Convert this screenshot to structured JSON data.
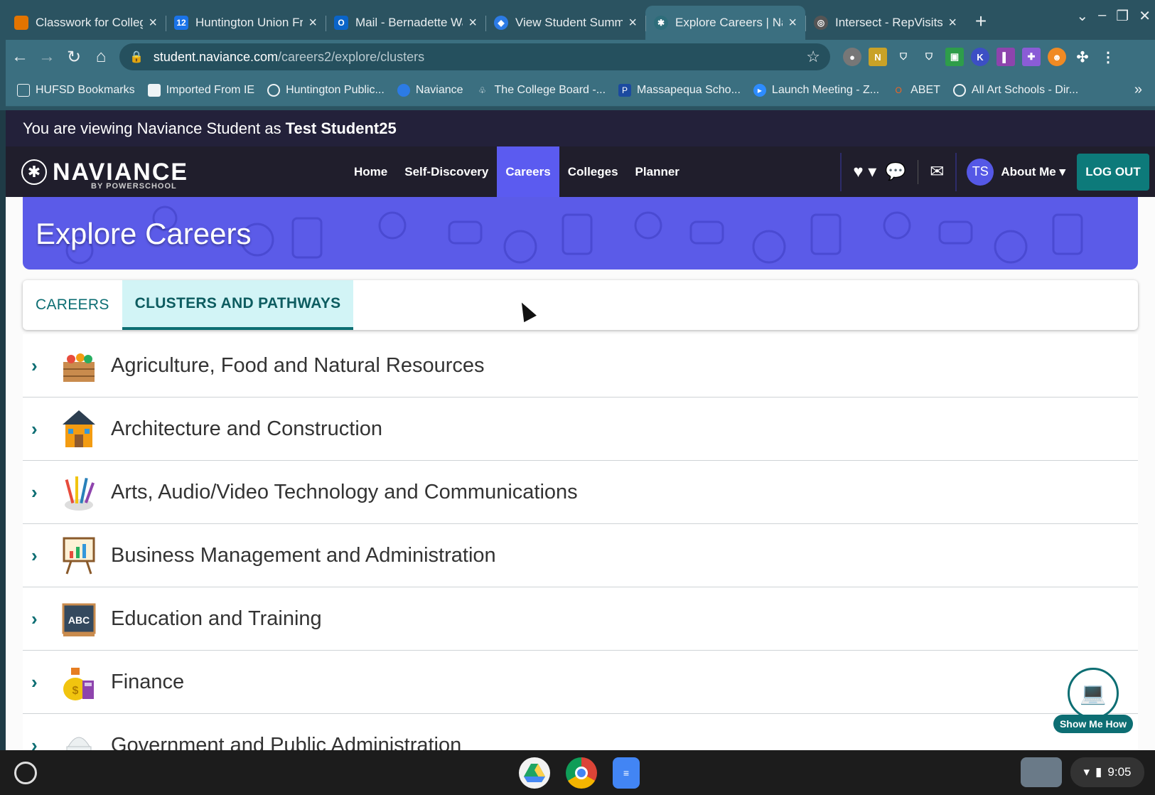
{
  "browser": {
    "tabs": [
      {
        "title": "Classwork for College C",
        "fav_color": "#e37400",
        "fav_glyph": "▮"
      },
      {
        "title": "Huntington Union Free",
        "fav_color": "#1a73e8",
        "fav_glyph": "12"
      },
      {
        "title": "Mail - Bernadette Walsh",
        "fav_color": "#0a64c8",
        "fav_glyph": "O"
      },
      {
        "title": "View Student Summary",
        "fav_color": "#2c7be5",
        "fav_glyph": "◆"
      },
      {
        "title": "Explore Careers | Navia",
        "fav_color": "#2e6d7a",
        "fav_glyph": "✱",
        "active": true
      },
      {
        "title": "Intersect - RepVisits",
        "fav_color": "#555555",
        "fav_glyph": "◎"
      }
    ],
    "url_host": "student.naviance.com",
    "url_path": "/careers2/explore/clusters",
    "bookmarks": [
      {
        "label": "HUFSD Bookmarks",
        "icon": "folder-icon"
      },
      {
        "label": "Imported From IE",
        "icon": "folder-icon"
      },
      {
        "label": "Huntington Public...",
        "icon": "globe-icon"
      },
      {
        "label": "Naviance",
        "icon": "naviance-icon"
      },
      {
        "label": "The College Board -...",
        "icon": "acorn-icon"
      },
      {
        "label": "Massapequa Scho...",
        "icon": "p-icon"
      },
      {
        "label": "Launch Meeting - Z...",
        "icon": "zoom-icon"
      },
      {
        "label": "ABET",
        "icon": "abet-icon"
      },
      {
        "label": "All Art Schools - Dir...",
        "icon": "globe-icon"
      }
    ]
  },
  "impersonation": {
    "prefix": "You are viewing Naviance Student as",
    "name": "Test Student25"
  },
  "nav": {
    "brand": "NAVIANCE",
    "brand_sub": "BY POWERSCHOOL",
    "links": [
      "Home",
      "Self-Discovery",
      "Careers",
      "Colleges",
      "Planner"
    ],
    "active": "Careers",
    "avatar": "TS",
    "about_me": "About Me ▾",
    "logout": "LOG OUT"
  },
  "hero": {
    "title": "Explore Careers"
  },
  "page_tabs": [
    {
      "label": "CAREERS",
      "selected": false
    },
    {
      "label": "CLUSTERS AND PATHWAYS",
      "selected": true
    }
  ],
  "clusters": [
    "Agriculture, Food and Natural Resources",
    "Architecture and Construction",
    "Arts, Audio/Video Technology and Communications",
    "Business Management and Administration",
    "Education and Training",
    "Finance",
    "Government and Public Administration"
  ],
  "help": {
    "label": "Show Me How"
  },
  "shelf": {
    "time": "9:05"
  },
  "colors": {
    "accent": "#5b5be8",
    "teal": "#0d6e73",
    "nav_bg": "#201e2c"
  }
}
